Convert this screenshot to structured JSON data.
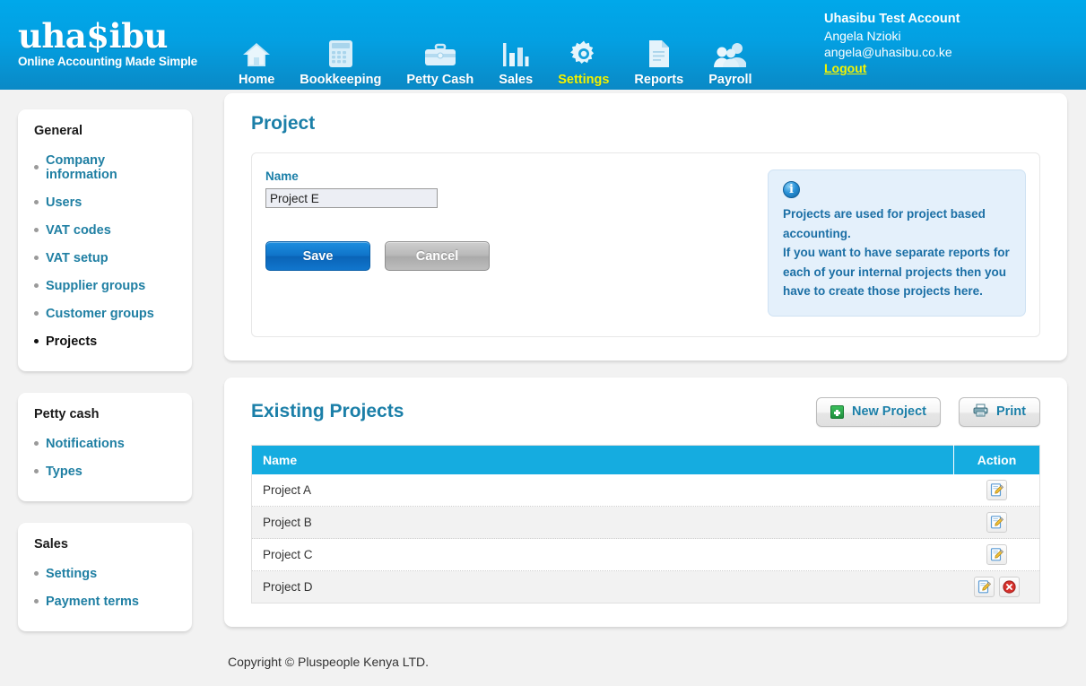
{
  "brand": {
    "logo_text": "uha$ibu",
    "tagline": "Online Accounting Made Simple"
  },
  "nav": {
    "items": [
      {
        "label": "Home",
        "icon": "home-icon",
        "active": false
      },
      {
        "label": "Bookkeeping",
        "icon": "calculator-icon",
        "active": false
      },
      {
        "label": "Petty Cash",
        "icon": "briefcase-icon",
        "active": false
      },
      {
        "label": "Sales",
        "icon": "bar-chart-icon",
        "active": false
      },
      {
        "label": "Settings",
        "icon": "gear-icon",
        "active": true
      },
      {
        "label": "Reports",
        "icon": "document-icon",
        "active": false
      },
      {
        "label": "Payroll",
        "icon": "people-icon",
        "active": false
      }
    ]
  },
  "account": {
    "company": "Uhasibu Test Account",
    "user": "Angela Nzioki",
    "email": "angela@uhasibu.co.ke",
    "logout_label": "Logout"
  },
  "sidebar": {
    "groups": [
      {
        "title": "General",
        "items": [
          {
            "label": "Company information",
            "active": false
          },
          {
            "label": "Users",
            "active": false
          },
          {
            "label": "VAT codes",
            "active": false
          },
          {
            "label": "VAT setup",
            "active": false
          },
          {
            "label": "Supplier groups",
            "active": false
          },
          {
            "label": "Customer groups",
            "active": false
          },
          {
            "label": "Projects",
            "active": true
          }
        ]
      },
      {
        "title": "Petty cash",
        "items": [
          {
            "label": "Notifications",
            "active": false
          },
          {
            "label": "Types",
            "active": false
          }
        ]
      },
      {
        "title": "Sales",
        "items": [
          {
            "label": "Settings",
            "active": false
          },
          {
            "label": "Payment terms",
            "active": false
          }
        ]
      }
    ]
  },
  "project_form": {
    "title": "Project",
    "name_label": "Name",
    "name_value": "Project E",
    "name_placeholder": "",
    "save_label": "Save",
    "cancel_label": "Cancel",
    "info": {
      "icon": "info-icon",
      "paragraph_1": "Projects are used for project based accounting.",
      "paragraph_2": "If you want to have separate reports for each of your internal projects then you have to create those projects here."
    }
  },
  "existing": {
    "title": "Existing Projects",
    "new_button_label": "New Project",
    "print_button_label": "Print",
    "columns": [
      "Name",
      "Action"
    ],
    "rows": [
      {
        "name": "Project A",
        "can_edit": true,
        "can_delete": false
      },
      {
        "name": "Project B",
        "can_edit": true,
        "can_delete": false
      },
      {
        "name": "Project C",
        "can_edit": true,
        "can_delete": false
      },
      {
        "name": "Project D",
        "can_edit": true,
        "can_delete": true
      }
    ]
  },
  "footer": {
    "copyright": "Copyright © Pluspeople Kenya LTD."
  },
  "colors": {
    "header_top": "#00a8ea",
    "header_bottom": "#0a89c6",
    "accent_teal": "#1b7fa8",
    "table_header": "#15ace0",
    "active_nav": "#f4f400",
    "page_bg": "#f2f2f2",
    "danger": "#d22b27"
  }
}
